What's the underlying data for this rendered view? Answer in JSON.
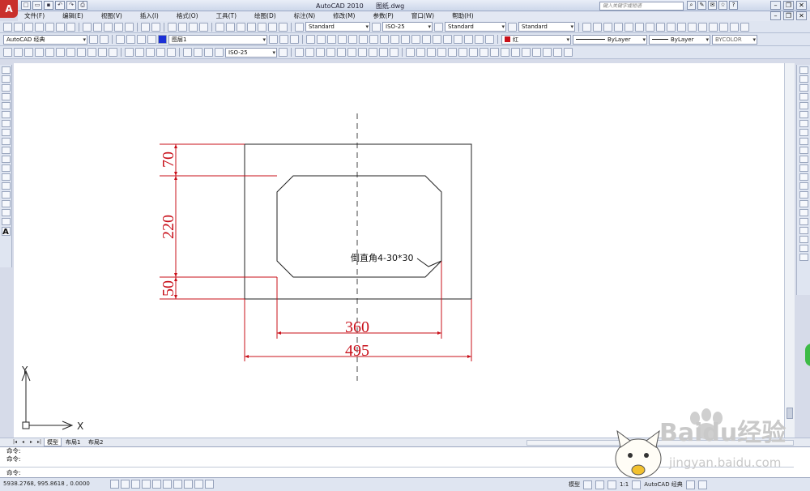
{
  "app": {
    "logo_text": "A",
    "title": "AutoCAD 2010",
    "file": "图纸.dwg",
    "search_placeholder": "键入关键字或短语"
  },
  "menu": [
    "文件(F)",
    "编辑(E)",
    "视图(V)",
    "插入(I)",
    "格式(O)",
    "工具(T)",
    "绘图(D)",
    "标注(N)",
    "修改(M)",
    "参数(P)",
    "窗口(W)",
    "帮助(H)"
  ],
  "toolbar": {
    "text_style": "Standard",
    "dim_style": "ISO-25",
    "table_style": "Standard",
    "mleader_style": "Standard",
    "workspace": "AutoCAD 经典",
    "layer": "图层1",
    "color": "红",
    "linetype": "ByLayer",
    "lineweight": "ByLayer",
    "plotstyle": "BYCOLOR",
    "dim_style_row3": "ISO-25"
  },
  "drawing": {
    "dimensions": {
      "top": "70",
      "middle": "220",
      "bottom": "50",
      "inner_width": "360",
      "outer_width": "495"
    },
    "annotation": "倒直角4-30*30",
    "ucs_y": "Y",
    "ucs_x": "X",
    "colors": {
      "dimension": "#c8101a",
      "geometry": "#222222",
      "centerline": "#444444"
    }
  },
  "tabs": [
    "模型",
    "布局1",
    "布局2"
  ],
  "command": {
    "history": [
      "命令:",
      "命令:"
    ],
    "prompt": "命令:"
  },
  "status": {
    "coords": "5938.2768, 995.8618 , 0.0000",
    "model_label": "模型",
    "scale": "1:1",
    "workspace": "AutoCAD 经典"
  },
  "watermark": {
    "brand": "Baidu经验",
    "url": "jingyan.baidu.com"
  }
}
